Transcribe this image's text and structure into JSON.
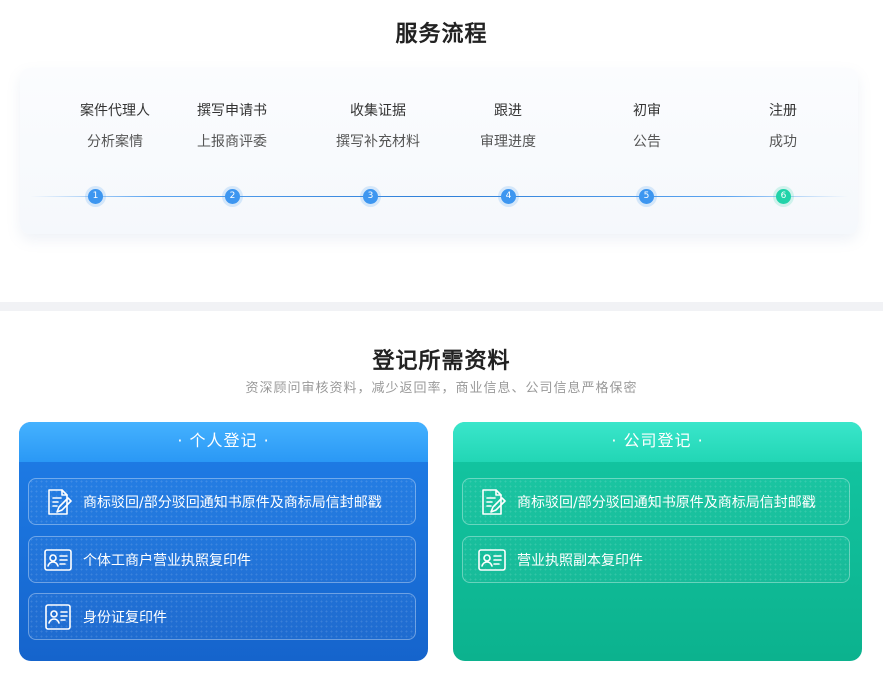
{
  "process": {
    "title": "服务流程",
    "steps": [
      {
        "line1": "案件代理人",
        "line2": "分析案情",
        "num": "1"
      },
      {
        "line1": "撰写申请书",
        "line2": "上报商评委",
        "num": "2"
      },
      {
        "line1": "收集证据",
        "line2": "撰写补充材料",
        "num": "3"
      },
      {
        "line1": "跟进",
        "line2": "审理进度",
        "num": "4"
      },
      {
        "line1": "初审",
        "line2": "公告",
        "num": "5"
      },
      {
        "line1": "注册",
        "line2": "成功",
        "num": "6"
      }
    ]
  },
  "materials": {
    "title": "登记所需资料",
    "subtitle": "资深顾问审核资料，减少返回率，商业信息、公司信息严格保密",
    "personal": {
      "title": "· 个人登记 ·",
      "items": [
        {
          "text": "商标驳回/部分驳回通知书原件及商标局信封邮戳",
          "icon": "document-edit-icon"
        },
        {
          "text": "个体工商户营业执照复印件",
          "icon": "license-icon"
        },
        {
          "text": "身份证复印件",
          "icon": "id-card-icon"
        }
      ]
    },
    "company": {
      "title": "· 公司登记 ·",
      "items": [
        {
          "text": "商标驳回/部分驳回通知书原件及商标局信封邮戳",
          "icon": "document-edit-icon"
        },
        {
          "text": "营业执照副本复印件",
          "icon": "license-icon"
        }
      ]
    }
  },
  "colors": {
    "blue_accent": "#1f7ee8",
    "green_accent": "#13c7a3",
    "step_dot": "#3d96f0",
    "final_dot": "#21d3a9"
  }
}
